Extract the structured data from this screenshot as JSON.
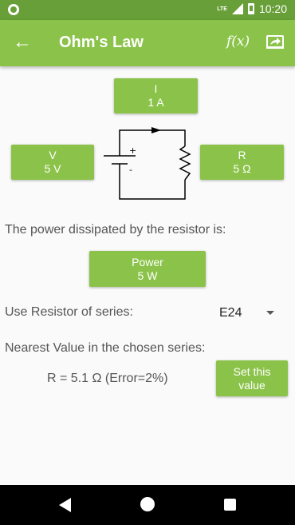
{
  "status": {
    "time": "10:20",
    "network": "LTE"
  },
  "appbar": {
    "title": "Ohm's Law",
    "function_label": "f(x)"
  },
  "buttons": {
    "current": {
      "label": "I",
      "value": "1 A"
    },
    "voltage": {
      "label": "V",
      "value": "5 V"
    },
    "resistance": {
      "label": "R",
      "value": "5 Ω"
    },
    "power": {
      "label": "Power",
      "value": "5 W"
    },
    "set_value": {
      "label_line1": "Set this",
      "label_line2": "value"
    }
  },
  "texts": {
    "power_dissipated": "The power dissipated by the resistor is:",
    "series_label": "Use Resistor of series:",
    "nearest_label": "Nearest Value in the chosen series:",
    "result": "R = 5.1 Ω  (Error=2%)"
  },
  "series_select": {
    "selected": "E24"
  },
  "colors": {
    "status_bar": "#689f38",
    "app_bar": "#8bc34a",
    "button": "#8bc34a"
  },
  "icons": [
    "back-arrow-icon",
    "function-icon",
    "share-icon",
    "nav-back-icon",
    "nav-home-icon",
    "nav-recent-icon"
  ]
}
